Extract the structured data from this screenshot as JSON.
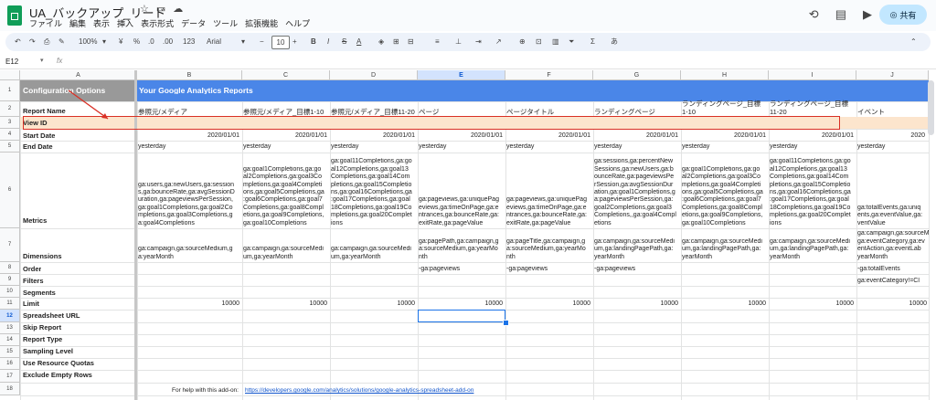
{
  "title": "UA_バックアップ_リード",
  "menu": [
    "ファイル",
    "編集",
    "表示",
    "挿入",
    "表示形式",
    "データ",
    "ツール",
    "拡張機能",
    "ヘルプ"
  ],
  "share_label": "共有",
  "toolbar": {
    "zoom": "100%",
    "currency": "¥",
    "percent": "%",
    "dec_dec": ".0",
    "dec_inc": ".00",
    "format_num": "123",
    "font": "Arial",
    "font_size": "10",
    "bold": "B",
    "italic": "I",
    "strike": "S",
    "text_color": "A",
    "lang": "あ"
  },
  "name_box": "E12",
  "fx": "fx",
  "columns": [
    "A",
    "B",
    "C",
    "D",
    "E",
    "F",
    "G",
    "H",
    "I",
    "J"
  ],
  "rows": [
    "1",
    "2",
    "3",
    "4",
    "5",
    "6",
    "7",
    "8",
    "9",
    "10",
    "11",
    "12",
    "13",
    "14",
    "15",
    "16",
    "17",
    "18"
  ],
  "a_labels": {
    "r1": "Configuration Options",
    "r2": "Report Name",
    "r3": "View ID",
    "r4": "Start Date",
    "r5": "End Date",
    "r6": "Metrics",
    "r7": "Dimensions",
    "r8": "Order",
    "r9": "Filters",
    "r10": "Segments",
    "r11": "Limit",
    "r12": "Spreadsheet URL",
    "r13": "Skip Report",
    "r14": "Report Type",
    "r15": "Sampling Level",
    "r16": "Use Resource Quotas",
    "r17": "Exclude Empty Rows"
  },
  "banner": "Your Google Analytics Reports",
  "report_names": [
    "参照元/メディア",
    "参照元/メディア_目標1-10",
    "参照元/メディア_目標11-20",
    "ページ",
    "ページタイトル",
    "ランディングページ",
    "ランディングページ_目標\n1-10",
    "ランディングページ_目標\n11-20",
    "イベント"
  ],
  "start_date": "2020/01/01",
  "start_date_j": "2020",
  "end_date": "yesterday",
  "metrics": [
    "ga:users,ga:newUsers,ga:session\ns,ga:bounceRate,ga:avgSessionD\nuration,ga:pageviewsPerSession,\nga:goal1Completions,ga:goal2Co\nmpletions,ga:goal3Completions,g\na:goal4Completions",
    "ga:goal1Completions,ga:go\nal2Completions,ga:goal3Co\nmpletions,ga:goal4Completi\nons,ga:goal5Completions,ga\n:goal6Completions,ga:goal7\nCompletions,ga:goal8Compl\netions,ga:goal9Completions,\nga:goal10Completions",
    "ga:goal11Completions,ga:go\nal12Completions,ga:goal13\nCompletions,ga:goal14Com\npletions,ga:goal15Completio\nns,ga:goal16Completions,ga\n:goal17Completions,ga:goal\n18Completions,ga:goal19Co\nmpletions,ga:goal20Complet\nions",
    "ga:pageviews,ga:uniquePag\neviews,ga:timeOnPage,ga:e\nntrances,ga:bounceRate,ga:\nexitRate,ga:pageValue",
    "ga:pageviews,ga:uniquePag\neviews,ga:timeOnPage,ga:e\nntrances,ga:bounceRate,ga:\nexitRate,ga:pageValue",
    "ga:sessions,ga:percentNew\nSessions,ga:newUsers,ga:b\nounceRate,ga:pageviewsPe\nrSession,ga:avgSessionDur\nation,ga:goal1Completions,g\na:pageviewsPerSession,ga:\ngoal2Completions,ga:goal3\nCompletions,,ga:goal4Compl\netions",
    "ga:goal1Completions,ga:go\nal2Completions,ga:goal3Co\nmpletions,ga:goal4Completi\nons,ga:goal5Completions,ga\n:goal6Completions,ga:goal7\nCompletions,ga:goal8Compl\netions,ga:goal9Completions,\nga:goal10Completions",
    "ga:goal11Completions,ga:go\nal12Completions,ga:goal13\nCompletions,ga:goal14Com\npletions,ga:goal15Completio\nns,ga:goal16Completions,ga\n:goal17Completions,ga:goal\n18Completions,ga:goal19Co\nmpletions,ga:goal20Complet\nions",
    "ga:totalEvents,ga:uniq\nents,ga:eventValue,ga:\nventValue"
  ],
  "dimensions": [
    "ga:campaign,ga:sourceMedium,g\na:yearMonth",
    "ga:campaign,ga:sourceMedi\num,ga:yearMonth",
    "ga:campaign,ga:sourceMedi\num,ga:yearMonth",
    "ga:pagePath,ga:campaign,g\na:sourceMedium,ga:yearMo\nnth",
    "ga:pageTitle,ga:campaign,g\na:sourceMedium,ga:yearMo\nnth",
    "ga:campaign,ga:sourceMedi\num,ga:landingPagePath,ga:\nyearMonth",
    "ga:campaign,ga:sourceMedi\num,ga:landingPagePath,ga:\nyearMonth",
    "ga:campaign,ga:sourceMedi\num,ga:landingPagePath,ga:\nyearMonth",
    "ga:campaign,ga:sourceMe\nga:eventCategory,ga:ev\nentAction,ga:eventLab\nyearMonth"
  ],
  "order": [
    "",
    "",
    "",
    "-ga:pageviews",
    "-ga:pageviews",
    "-ga:pageviews",
    "",
    "",
    "-ga:totalEvents"
  ],
  "filters_j": "ga:eventCategory!=Cl",
  "limit": "10000",
  "help_text": "For help with this add-on:",
  "help_link": "https://developers.google.com/analytics/solutions/google-analytics-spreadsheet-add-on",
  "colors": {
    "accent_blue": "#4a86e8",
    "config_gray": "#999999",
    "viewid_peach": "#fce5cd",
    "red_highlight": "#d93025",
    "selection": "#1a73e8"
  }
}
